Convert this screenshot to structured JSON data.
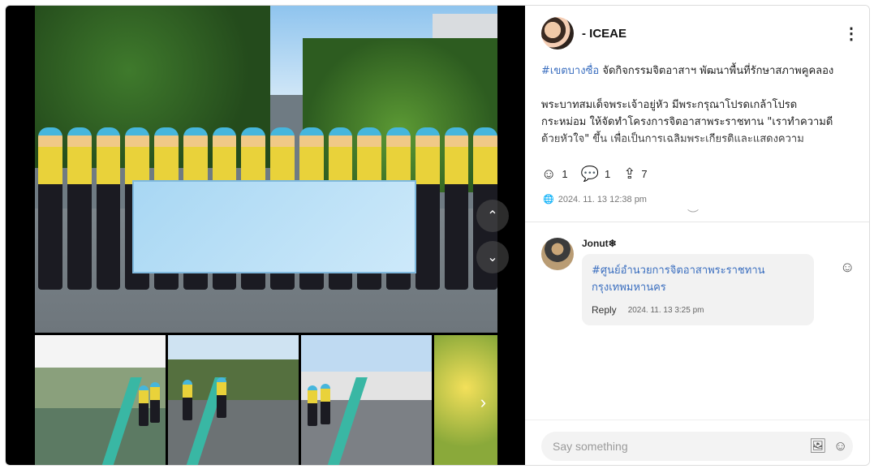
{
  "post": {
    "username": "- ICEAE",
    "caption_tag": "#เขตบางซื่อ",
    "caption_line1": " จัดกิจกรรมจิตอาสาฯ พัฒนาพื้นที่รักษาสภาพคูคลอง",
    "caption_line2": "พระบาทสมเด็จพระเจ้าอยู่หัว มีพระกรุณาโปรดเกล้าโปรดกระหม่อม ให้จัดทำโครงการจิตอาสาพระราชทาน \"เราทำความดี ด้วยหัวใจ\" ขึ้น เพื่อเป็นการเฉลิมพระเกียรติและแสดงความ",
    "reactions": "1",
    "comments": "1",
    "shares": "7",
    "timestamp": "2024. 11. 13 12:38 pm"
  },
  "comment": {
    "author": "Jonut❄",
    "text": "#ศูนย์อำนวยการจิตอาสาพระราชทาน กรุงเทพมหานคร",
    "reply_label": "Reply",
    "time": "2024. 11. 13 3:25 pm"
  },
  "composer": {
    "placeholder": "Say something"
  },
  "icons": {
    "more": "more-vertical-icon",
    "smile": "smile-icon",
    "comment": "comment-icon",
    "share": "share-icon",
    "globe": "globe-icon",
    "image": "image-icon"
  }
}
